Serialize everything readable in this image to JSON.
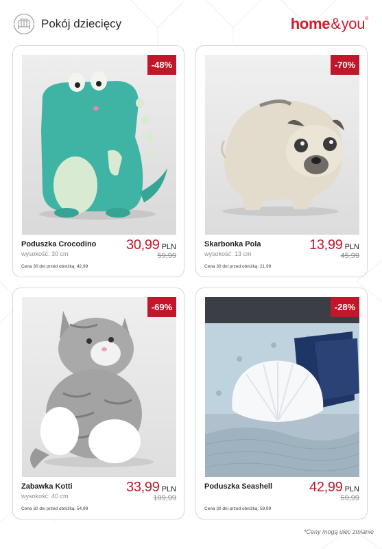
{
  "header": {
    "category_icon": "crib-icon",
    "category_title": "Pokój dziecięcy",
    "logo": {
      "part1": "home",
      "amp": "&",
      "part2": "you",
      "reg": "®"
    }
  },
  "products": [
    {
      "name": "Poduszka Crocodino",
      "height": "wysokość: 30 cm",
      "price": "30,99",
      "currency": "PLN",
      "old_price": "59,99",
      "discount": "-48%",
      "note": "Cena 30 dni przed obniżką: 42,99"
    },
    {
      "name": "Skarbonka Pola",
      "height": "wysokość: 13 cm",
      "price": "13,99",
      "currency": "PLN",
      "old_price": "45,99",
      "discount": "-70%",
      "note": "Cena 30 dni przed obniżką: 21,99"
    },
    {
      "name": "Zabawka Kotti",
      "height": "wysokość: 40 cm",
      "price": "33,99",
      "currency": "PLN",
      "old_price": "109,99",
      "discount": "-69%",
      "note": "Cena 30 dni przed obniżką: 54,99"
    },
    {
      "name": "Poduszka Seashell",
      "height": "",
      "price": "42,99",
      "currency": "PLN",
      "old_price": "59,99",
      "discount": "-28%",
      "note": "Cena 30 dni przed obniżką: 59,99"
    }
  ],
  "footnote": "*Ceny mogą ulec zmianie",
  "colors": {
    "brand": "#d01b2a",
    "badge": "#c0182a",
    "price": "#c0182a"
  }
}
